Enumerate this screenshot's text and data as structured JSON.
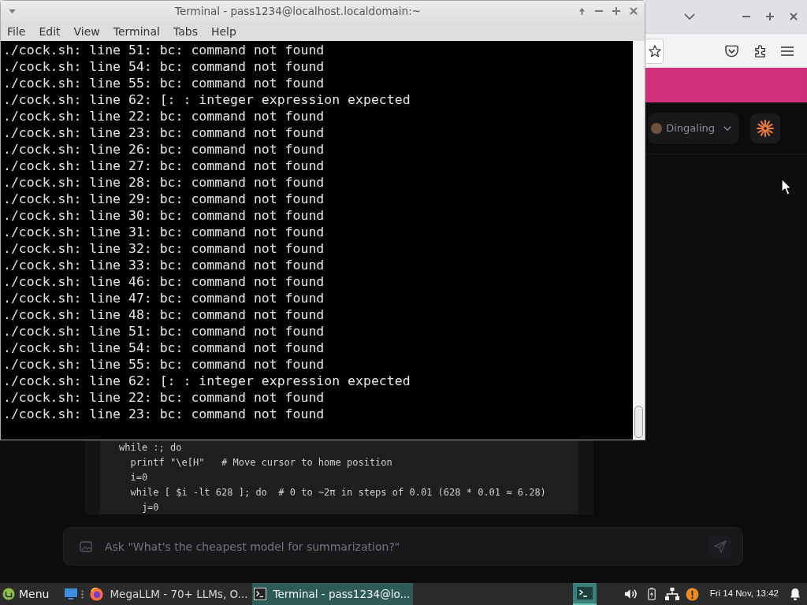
{
  "terminal_window": {
    "title": "Terminal - pass1234@localhost.localdomain:~",
    "menu": [
      "File",
      "Edit",
      "View",
      "Terminal",
      "Tabs",
      "Help"
    ],
    "lines": [
      "./cock.sh: line 51: bc: command not found",
      "./cock.sh: line 54: bc: command not found",
      "./cock.sh: line 55: bc: command not found",
      "./cock.sh: line 62: [: : integer expression expected",
      "./cock.sh: line 22: bc: command not found",
      "./cock.sh: line 23: bc: command not found",
      "./cock.sh: line 26: bc: command not found",
      "./cock.sh: line 27: bc: command not found",
      "./cock.sh: line 28: bc: command not found",
      "./cock.sh: line 29: bc: command not found",
      "./cock.sh: line 30: bc: command not found",
      "./cock.sh: line 31: bc: command not found",
      "./cock.sh: line 32: bc: command not found",
      "./cock.sh: line 33: bc: command not found",
      "./cock.sh: line 46: bc: command not found",
      "./cock.sh: line 47: bc: command not found",
      "./cock.sh: line 48: bc: command not found",
      "./cock.sh: line 51: bc: command not found",
      "./cock.sh: line 54: bc: command not found",
      "./cock.sh: line 55: bc: command not found",
      "./cock.sh: line 62: [: : integer expression expected",
      "./cock.sh: line 22: bc: command not found",
      "./cock.sh: line 23: bc: command not found"
    ]
  },
  "browser_window": {
    "profile_menu": {
      "label": "Dingaling"
    },
    "code_lines": [
      "while :; do",
      "  printf \"\\e[H\"   # Move cursor to home position",
      "  i=0",
      "  while [ $i -lt 628 ]; do  # 0 to ~2π in steps of 0.01 (628 * 0.01 ≈ 6.28)",
      "    j=0"
    ],
    "chat_input": {
      "placeholder": "Ask \"What's the cheapest model for summarization?\""
    }
  },
  "taskbar": {
    "menu_label": "Menu",
    "tasks": [
      {
        "kind": "browser",
        "label": "MegaLLM - 70+ LLMs, O...",
        "selected": false
      },
      {
        "kind": "terminal",
        "label": "Terminal - pass1234@lo...",
        "selected": true
      }
    ],
    "clock": "Fri 14 Nov, 13:42"
  }
}
